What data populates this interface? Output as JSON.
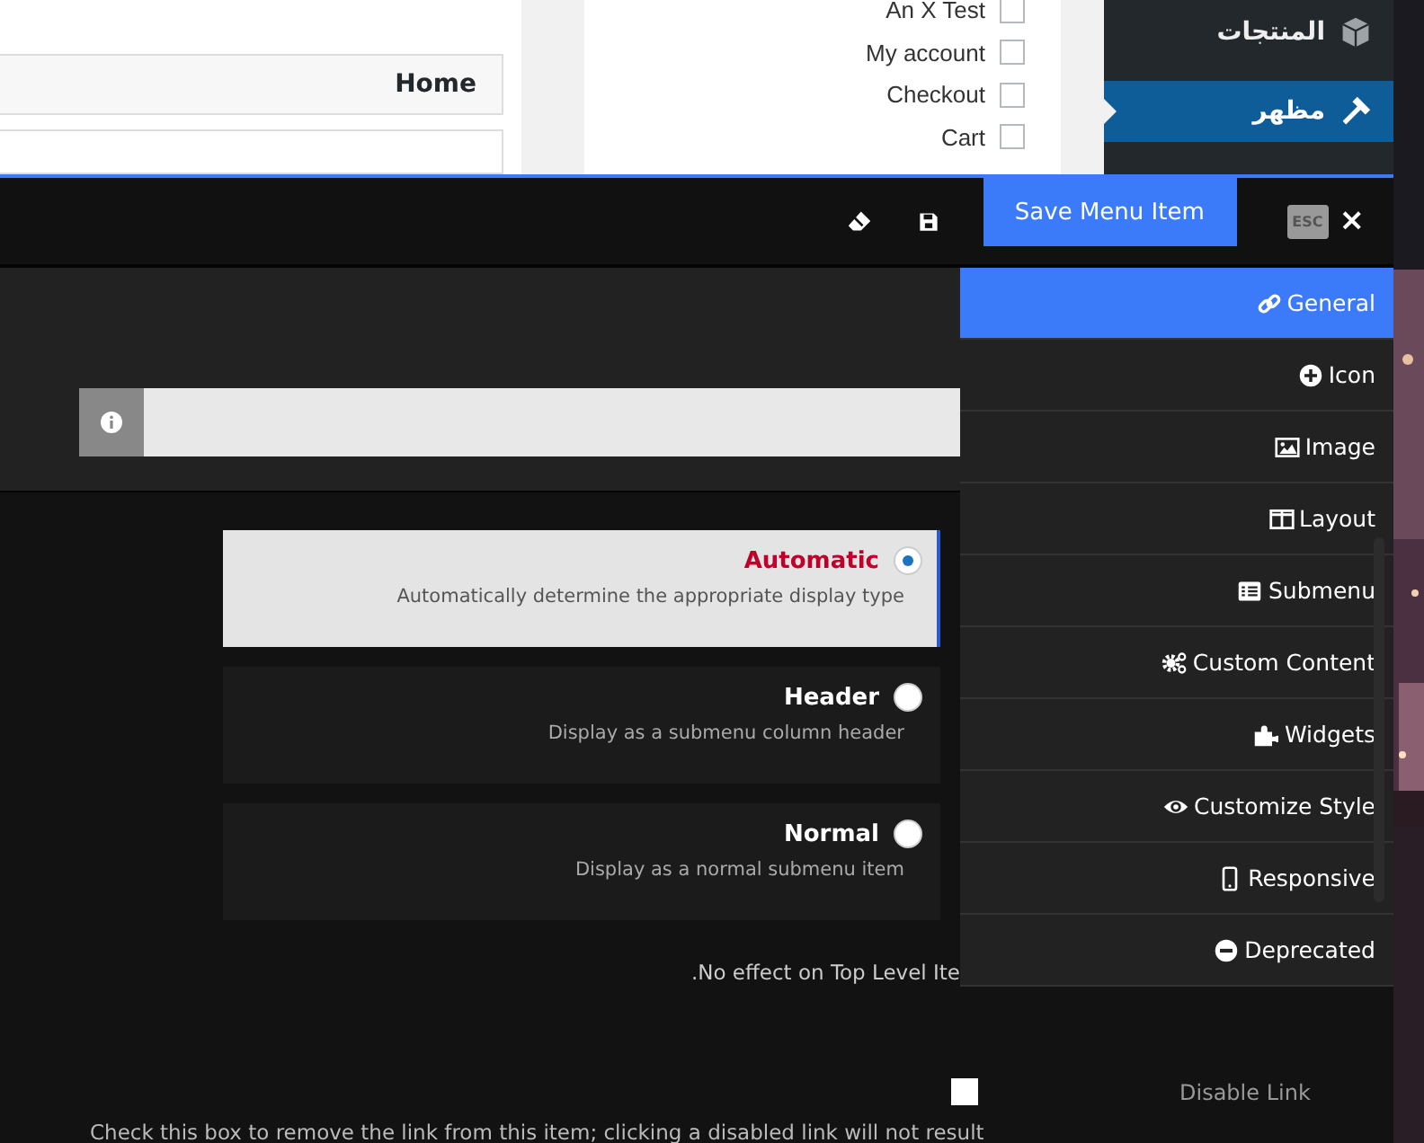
{
  "background": {
    "home_label": "Home",
    "pages": [
      {
        "label": "An X Test",
        "checked": false
      },
      {
        "label": "My account",
        "checked": false
      },
      {
        "label": "Checkout",
        "checked": false
      },
      {
        "label": "Cart",
        "checked": false
      }
    ],
    "admin_menu": [
      {
        "label": "المنتجات",
        "selected": false
      },
      {
        "label": "مظهر",
        "selected": true
      }
    ]
  },
  "modal": {
    "save_button": "Save Menu Item",
    "esc_badge": "ESC",
    "close": "×",
    "tabs": [
      {
        "label": "General",
        "selected": true
      },
      {
        "label": "Icon",
        "selected": false
      },
      {
        "label": "Image",
        "selected": false
      },
      {
        "label": "Layout",
        "selected": false
      },
      {
        "label": "Submenu",
        "selected": false
      },
      {
        "label": "Custom Content",
        "selected": false
      },
      {
        "label": "Widgets",
        "selected": false
      },
      {
        "label": "Customize Style",
        "selected": false
      },
      {
        "label": "Responsive",
        "selected": false
      },
      {
        "label": "Deprecated",
        "selected": false
      }
    ],
    "display_options": [
      {
        "title": "Automatic",
        "description": "Automatically determine the appropriate display type",
        "selected": true
      },
      {
        "title": "Header",
        "description": "Display as a submenu column header",
        "selected": false
      },
      {
        "title": "Normal",
        "description": "Display as a normal submenu item",
        "selected": false
      }
    ],
    "note": ".No effect on Top Level Ite",
    "disable_link": {
      "label": "Disable Link",
      "checked": false,
      "description": "Check this box to remove the link from this item; clicking a disabled link will not result"
    }
  }
}
